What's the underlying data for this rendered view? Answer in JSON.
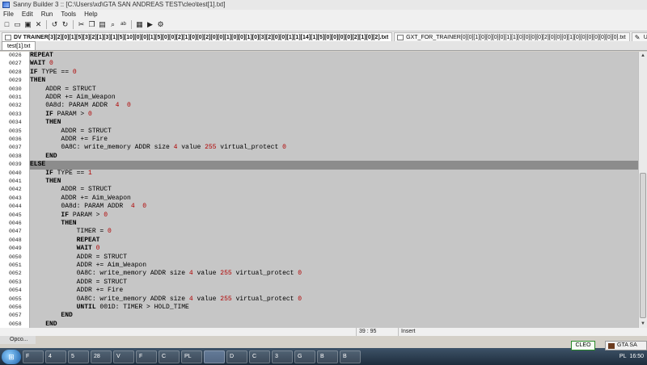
{
  "window": {
    "title": "Sanny Builder 3 :: [C:\\Users\\xd\\GTA SAN ANDREAS TEST\\cleo\\test[1].txt]"
  },
  "menu": [
    "File",
    "Edit",
    "Run",
    "Tools",
    "Help"
  ],
  "toolbar": {
    "icons": [
      "new-icon",
      "open-icon",
      "save-icon",
      "close-icon",
      "undo-icon",
      "redo-icon",
      "cut-icon",
      "copy-icon",
      "paste-icon",
      "find-icon",
      "replace-icon",
      "compile-icon",
      "run-icon",
      "settings-icon"
    ]
  },
  "doc_tabs": [
    {
      "label": "DV TRAINER[3][2][0][1][5][3][2][1][3][1][5][10][0][0][1][5][0][0][2][1][0][0][2][0][0][1][0][0][1][0][3][2][0][0][1][1][14][1][5][0][0][0][0][2][1][0][2].txt"
    },
    {
      "label": "GXT_FOR_TRAINER[0][0][1][0][0][0][0][1][1][0][0][0][0][2][0][0][0][1][0][0][0][0][0][0][0].txt"
    },
    {
      "label": "Untitled16"
    }
  ],
  "file_tab": "test[1].txt",
  "current_line": "0039",
  "lines": [
    {
      "num": "0026",
      "segs": [
        [
          "REPEAT",
          "kw"
        ]
      ]
    },
    {
      "num": "0027",
      "segs": [
        [
          "WAIT ",
          "kw"
        ],
        [
          "0",
          "num"
        ]
      ]
    },
    {
      "num": "0028",
      "segs": [
        [
          "IF ",
          "kw"
        ],
        [
          "TYPE == ",
          ""
        ],
        [
          "0",
          "num"
        ]
      ]
    },
    {
      "num": "0029",
      "segs": [
        [
          "THEN",
          "kw"
        ]
      ]
    },
    {
      "num": "0030",
      "segs": [
        [
          "    ADDR = STRUCT",
          ""
        ]
      ]
    },
    {
      "num": "0031",
      "segs": [
        [
          "    ADDR += Aim_Weapon",
          ""
        ]
      ]
    },
    {
      "num": "0032",
      "segs": [
        [
          "    0A8d: PARAM ADDR  ",
          ""
        ],
        [
          "4",
          "num"
        ],
        [
          "  ",
          ""
        ],
        [
          "0",
          "num"
        ]
      ]
    },
    {
      "num": "0033",
      "segs": [
        [
          "    IF ",
          "kw"
        ],
        [
          "PARAM > ",
          ""
        ],
        [
          "0",
          "num"
        ]
      ]
    },
    {
      "num": "0034",
      "segs": [
        [
          "    THEN",
          "kw"
        ]
      ]
    },
    {
      "num": "0035",
      "segs": [
        [
          "        ADDR = STRUCT",
          ""
        ]
      ]
    },
    {
      "num": "0036",
      "segs": [
        [
          "        ADDR += Fire",
          ""
        ]
      ]
    },
    {
      "num": "0037",
      "segs": [
        [
          "        0A8C: write_memory ADDR size ",
          ""
        ],
        [
          "4",
          "num"
        ],
        [
          " value ",
          ""
        ],
        [
          "255",
          "num"
        ],
        [
          " virtual_protect ",
          ""
        ],
        [
          "0",
          "num"
        ]
      ]
    },
    {
      "num": "0038",
      "segs": [
        [
          "    END",
          "kw"
        ]
      ]
    },
    {
      "num": "0039",
      "segs": [
        [
          "ELSE",
          "kw"
        ]
      ]
    },
    {
      "num": "0040",
      "segs": [
        [
          "    IF ",
          "kw"
        ],
        [
          "TYPE == ",
          ""
        ],
        [
          "1",
          "num"
        ]
      ]
    },
    {
      "num": "0041",
      "segs": [
        [
          "    THEN",
          "kw"
        ]
      ]
    },
    {
      "num": "0042",
      "segs": [
        [
          "        ADDR = STRUCT",
          ""
        ]
      ]
    },
    {
      "num": "0043",
      "segs": [
        [
          "        ADDR += Aim_Weapon",
          ""
        ]
      ]
    },
    {
      "num": "0044",
      "segs": [
        [
          "        0A8d: PARAM ADDR  ",
          ""
        ],
        [
          "4",
          "num"
        ],
        [
          "  ",
          ""
        ],
        [
          "0",
          "num"
        ]
      ]
    },
    {
      "num": "0045",
      "segs": [
        [
          "        IF ",
          "kw"
        ],
        [
          "PARAM > ",
          ""
        ],
        [
          "0",
          "num"
        ]
      ]
    },
    {
      "num": "0046",
      "segs": [
        [
          "        THEN",
          "kw"
        ]
      ]
    },
    {
      "num": "0047",
      "segs": [
        [
          "            TIMER = ",
          ""
        ],
        [
          "0",
          "num"
        ]
      ]
    },
    {
      "num": "0048",
      "segs": [
        [
          "            REPEAT",
          "kw"
        ]
      ]
    },
    {
      "num": "0049",
      "segs": [
        [
          "            WAIT ",
          "kw"
        ],
        [
          "0",
          "num"
        ]
      ]
    },
    {
      "num": "0050",
      "segs": [
        [
          "            ADDR = STRUCT",
          ""
        ]
      ]
    },
    {
      "num": "0051",
      "segs": [
        [
          "            ADDR += Aim_Weapon",
          ""
        ]
      ]
    },
    {
      "num": "0052",
      "segs": [
        [
          "            0A8C: write_memory ADDR size ",
          ""
        ],
        [
          "4",
          "num"
        ],
        [
          " value ",
          ""
        ],
        [
          "255",
          "num"
        ],
        [
          " virtual_protect ",
          ""
        ],
        [
          "0",
          "num"
        ]
      ]
    },
    {
      "num": "0053",
      "segs": [
        [
          "            ADDR = STRUCT",
          ""
        ]
      ]
    },
    {
      "num": "0054",
      "segs": [
        [
          "            ADDR += Fire",
          ""
        ]
      ]
    },
    {
      "num": "0055",
      "segs": [
        [
          "            0A8C: write_memory ADDR size ",
          ""
        ],
        [
          "4",
          "num"
        ],
        [
          " value ",
          ""
        ],
        [
          "255",
          "num"
        ],
        [
          " virtual_protect ",
          ""
        ],
        [
          "0",
          "num"
        ]
      ]
    },
    {
      "num": "0056",
      "segs": [
        [
          "            UNTIL ",
          "kw"
        ],
        [
          "001D: TIMER > HOLD_TIME",
          ""
        ]
      ]
    },
    {
      "num": "0057",
      "segs": [
        [
          "        END",
          "kw"
        ]
      ]
    },
    {
      "num": "0058",
      "segs": [
        [
          "    END",
          "kw"
        ]
      ]
    }
  ],
  "status": {
    "position": "39 : 95",
    "mode": "Insert"
  },
  "panel_tab": "Opco...",
  "cleo_label": "CLEO",
  "tray_tab": "GTA SA",
  "taskbar": {
    "items": [
      "F",
      "4",
      "5",
      "28",
      "V",
      "F",
      "C",
      "PL",
      "",
      "D",
      "C",
      "3",
      "G",
      "B",
      "B"
    ],
    "lang": "PL",
    "clock": "16:50"
  }
}
